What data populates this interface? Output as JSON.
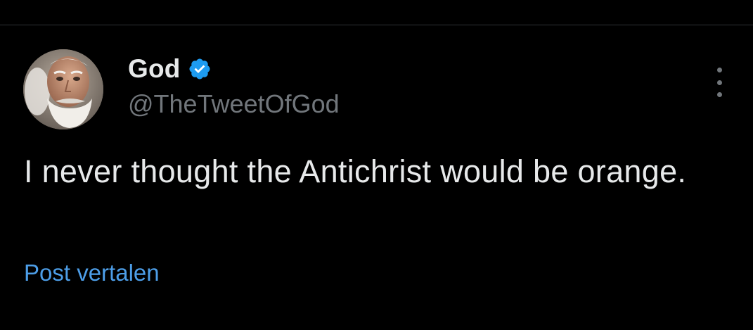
{
  "author": {
    "display_name": "God",
    "handle": "@TheTweetOfGod",
    "verified": true
  },
  "tweet": {
    "text": "I never thought the Antichrist would be orange."
  },
  "actions": {
    "translate_label": "Post vertalen",
    "more_icon": "more-vertical-icon"
  },
  "colors": {
    "background": "#000000",
    "text_primary": "#e7e9ea",
    "text_secondary": "#71767b",
    "link": "#4d9ee8",
    "verified_badge": "#1d9bf0"
  }
}
